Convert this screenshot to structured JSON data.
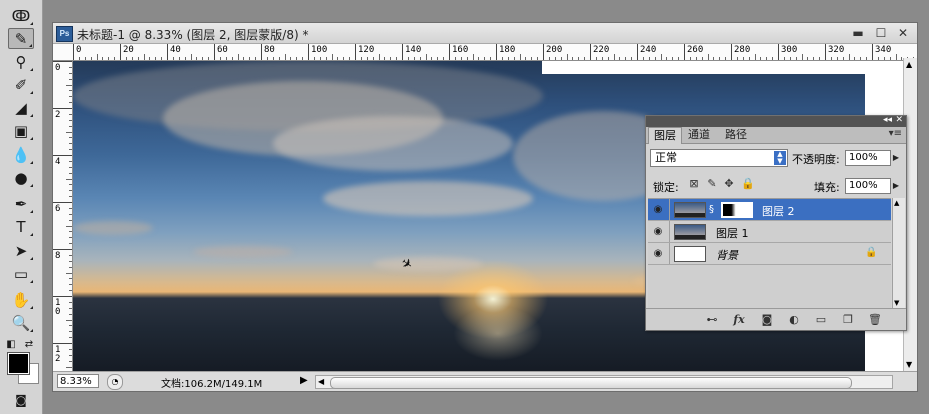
{
  "document": {
    "title": "未标题-1 @ 8.33% (图层 2, 图层蒙版/8) *",
    "app_badge": "Ps",
    "controls": {
      "minimize": "▬",
      "maximize": "☐",
      "close": "✕"
    }
  },
  "ruler": {
    "top_labels": [
      "0",
      "20",
      "40",
      "60",
      "80",
      "100",
      "120",
      "140",
      "160",
      "180",
      "200",
      "220",
      "240",
      "260",
      "280",
      "300",
      "320",
      "340"
    ],
    "left_labels": [
      "0",
      "2",
      "4",
      "6",
      "8",
      "10",
      "12"
    ]
  },
  "status": {
    "zoom": "8.33%",
    "doc_info": "文档:106.2M/149.1M",
    "arrow": "▶",
    "scroll_left": "◀",
    "scroll_right": "▶"
  },
  "layers_panel": {
    "tabs": [
      "图层",
      "通道",
      "路径"
    ],
    "active_tab": "图层",
    "blend_mode": "正常",
    "opacity_label": "不透明度:",
    "opacity_value": "100%",
    "lock_label": "锁定:",
    "fill_label": "填充:",
    "fill_value": "100%",
    "layers": [
      {
        "name": "图层 2",
        "selected": true,
        "has_mask": true
      },
      {
        "name": "图层 1",
        "selected": false,
        "has_mask": false
      },
      {
        "name": "背景",
        "selected": false,
        "locked": true
      }
    ],
    "icons": [
      "link-icon",
      "fx-icon",
      "add-mask-icon",
      "adjustment-icon",
      "new-group-icon",
      "new-layer-icon",
      "trash-icon"
    ],
    "fx_label": "fx"
  },
  "tools": [
    "lasso-tool-icon",
    "brush-tool-icon",
    "clone-stamp-tool-icon",
    "history-brush-tool-icon",
    "eraser-tool-icon",
    "gradient-tool-icon",
    "blur-tool-icon",
    "dodge-tool-icon",
    "pen-tool-icon",
    "type-tool-icon",
    "path-selection-tool-icon",
    "rectangle-tool-icon",
    "hand-tool-icon",
    "zoom-tool-icon"
  ],
  "colors": {
    "selection": "#3b6fc1",
    "foreground": "#000000",
    "background": "#ffffff"
  }
}
